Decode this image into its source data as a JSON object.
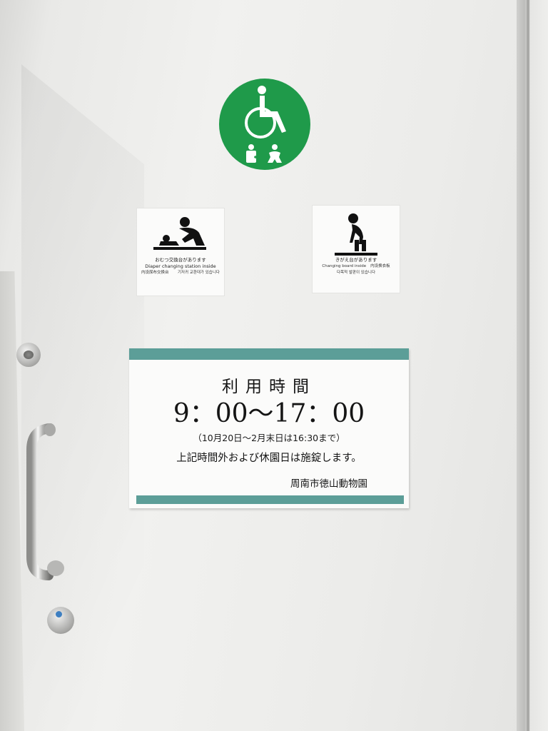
{
  "signage": {
    "accessible_badge": {
      "color": "#1f9a4a",
      "icons": [
        "wheelchair-icon",
        "ostomate-icon",
        "baby-icon"
      ]
    },
    "diaper_sticker": {
      "icon": "diaper-changing-icon",
      "japanese": "おむつ交換台があります",
      "english": "Diaper changing station inside",
      "chinese": "内设尿布交换台",
      "korean": "기저귀 교환대가 있습니다"
    },
    "changing_sticker": {
      "icon": "changing-board-icon",
      "japanese": "きがえ台があります",
      "english": "Changing board inside",
      "chinese": "内设换衣板",
      "korean": "다목적 발판이 있습니다"
    },
    "hours_sign": {
      "title": "利用時間",
      "hours": "9：00～17：00",
      "seasonal_note": "（10月20日～2月末日は16:30まで）",
      "closure_note": "上記時間外および休園日は施錠します。",
      "owner": "周南市徳山動物園",
      "accent_color": "#5c9e98"
    }
  }
}
